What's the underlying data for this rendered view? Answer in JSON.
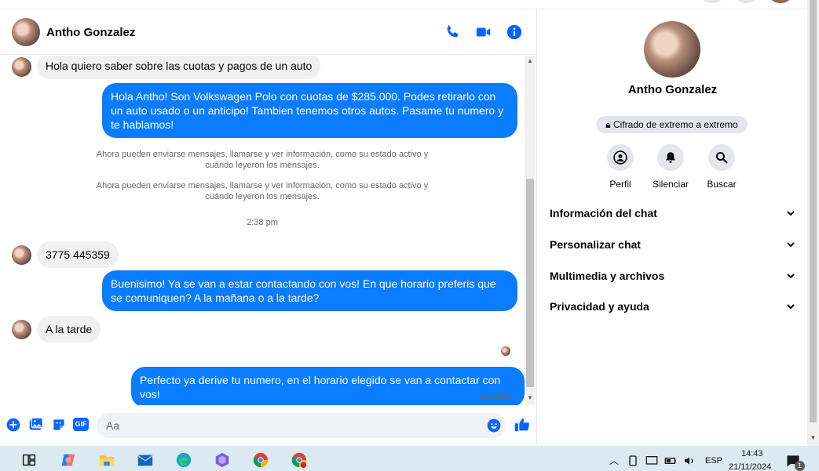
{
  "contact": {
    "name": "Antho Gonzalez"
  },
  "messages": {
    "m1": "Hola quiero saber sobre las cuotas y pagos de un auto",
    "m2": "Hola Antho!  Son Volkswagen Polo con cuotas de $285.000. Podes retirarlo con un auto usado o un anticipo! Tambien tenemos otros autos. Pasame tu numero y te hablamos!",
    "sys1": "Ahora pueden enviarse mensajes, llamarse y ver información, como su estado activo y cuándo leyeron los mensajes.",
    "sys2": "Ahora pueden enviarse mensajes, llamarse y ver información, como su estado activo y cuándo leyeron los mensajes.",
    "time": "2:38 pm",
    "m3": "3775 445359",
    "m4": "Buenisimo! Ya se van a estar contactando con vos! En que horario preferis que se comuniquen? A la mañana o a la tarde?",
    "m5": "A la tarde",
    "m6": "Perfecto ya derive tu numero, en el horario elegido se van a contactar con vos!",
    "status": "Enviado"
  },
  "composer": {
    "placeholder": "Aa",
    "gif_label": "GIF"
  },
  "info": {
    "name": "Antho Gonzalez",
    "e2e": "Cifrado de extremo a extremo",
    "actions": {
      "profile": "Perfil",
      "mute": "Silenciar",
      "search": "Buscar"
    },
    "sections": {
      "chat_info": "Información del chat",
      "customize": "Personalizar chat",
      "media": "Multimedia y archivos",
      "privacy": "Privacidad y ayuda"
    }
  },
  "taskbar": {
    "lang": "ESP",
    "time": "14:43",
    "date": "21/11/2024",
    "notif_count": "1"
  },
  "colors": {
    "accent": "#0a7cff",
    "brand": "#0866ff",
    "incoming": "#f0f0f0",
    "taskbar": "#dbe9f1"
  }
}
